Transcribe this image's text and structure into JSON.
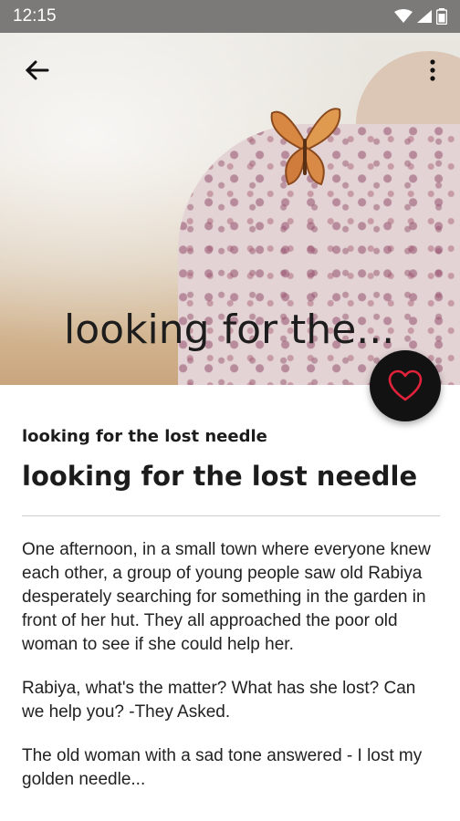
{
  "status_bar": {
    "time": "12:15"
  },
  "hero": {
    "title": "looking for the..."
  },
  "article": {
    "subtitle": "looking for the lost needle",
    "title": "looking for the lost needle",
    "paragraphs": [
      "One afternoon, in a small town where everyone knew each other, a group of young people saw old Rabiya desperately searching for something in the garden in front of her hut. They all approached the poor old woman to see if she could help her.",
      "Rabiya, what's the matter? What has she lost? Can we help you? -They Asked.",
      "The old woman with a sad tone answered - I lost my golden needle..."
    ]
  },
  "colors": {
    "status_bar_bg": "#7b7a79",
    "fab_bg": "#121212",
    "heart_accent": "#e0223a"
  },
  "icons": {
    "back": "arrow-back-icon",
    "more": "more-vert-icon",
    "favorite": "heart-icon"
  }
}
